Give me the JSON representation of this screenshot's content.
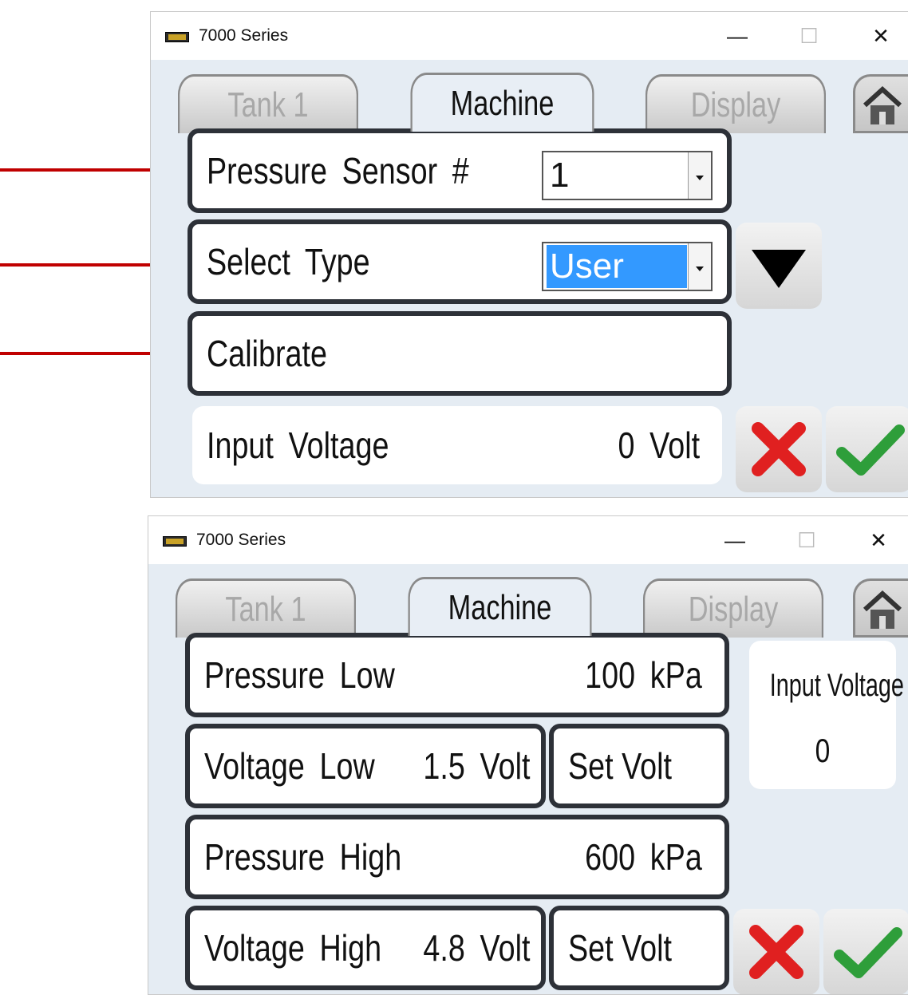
{
  "window_title": "7000 Series",
  "titlebar_buttons": {
    "minimize": "—",
    "maximize": "☐",
    "close": "✕"
  },
  "tabs": {
    "tank": "Tank 1",
    "machine": "Machine",
    "display": "Display"
  },
  "colors": {
    "accent_red": "#c00000",
    "selected_blue": "#3399ff",
    "cancel_red": "#e02020",
    "ok_green": "#2e9e3a"
  },
  "icons": {
    "home": "home-icon",
    "down": "down-arrow-icon",
    "cancel": "cancel-icon",
    "ok": "checkmark-icon",
    "arrow": "annotation-arrow"
  },
  "screen1": {
    "pressure_sensor": {
      "label": "Pressure Sensor #",
      "value": "1"
    },
    "select_type": {
      "label": "Select Type",
      "value": "User"
    },
    "calibrate": {
      "label": "Calibrate"
    },
    "input_voltage": {
      "label": "Input Voltage",
      "value": "0 Volt"
    }
  },
  "screen2": {
    "pressure_low": {
      "label": "Pressure Low",
      "value": "100 kPa"
    },
    "voltage_low": {
      "label": "Voltage Low",
      "value": "1.5 Volt",
      "button": "Set Volt"
    },
    "pressure_high": {
      "label": "Pressure High",
      "value": "600 kPa"
    },
    "voltage_high": {
      "label": "Voltage High",
      "value": "4.8 Volt",
      "button": "Set Volt"
    },
    "input_voltage_panel": {
      "label": "Input Voltage",
      "value": "0"
    }
  }
}
